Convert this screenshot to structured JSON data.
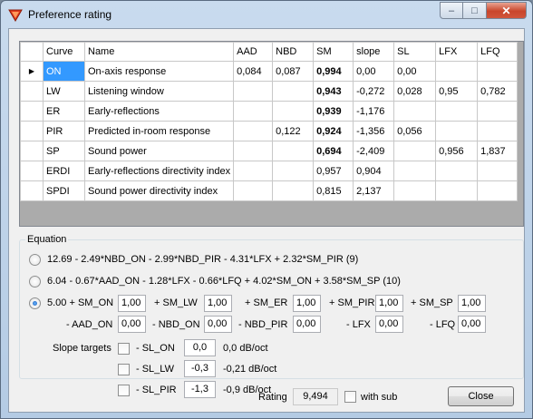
{
  "window": {
    "title": "Preference rating"
  },
  "caption_buttons": {
    "minimize": "–",
    "maximize": "□",
    "close": "✕"
  },
  "grid": {
    "columns": [
      "Curve",
      "Name",
      "AAD",
      "NBD",
      "SM",
      "slope",
      "SL",
      "LFX",
      "LFQ"
    ],
    "current_row_marker": "▶",
    "rows": [
      {
        "curve": "ON",
        "name": "On-axis response",
        "aad": "0,084",
        "nbd": "0,087",
        "sm": "0,994",
        "slope": "0,00",
        "sl": "0,00",
        "lfx": "",
        "lfq": ""
      },
      {
        "curve": "LW",
        "name": "Listening window",
        "aad": "",
        "nbd": "",
        "sm": "0,943",
        "slope": "-0,272",
        "sl": "0,028",
        "lfx": "0,95",
        "lfq": "0,782"
      },
      {
        "curve": "ER",
        "name": "Early-reflections",
        "aad": "",
        "nbd": "",
        "sm": "0,939",
        "slope": "-1,176",
        "sl": "",
        "lfx": "",
        "lfq": ""
      },
      {
        "curve": "PIR",
        "name": "Predicted in-room response",
        "aad": "",
        "nbd": "0,122",
        "sm": "0,924",
        "slope": "-1,356",
        "sl": "0,056",
        "lfx": "",
        "lfq": ""
      },
      {
        "curve": "SP",
        "name": "Sound power",
        "aad": "",
        "nbd": "",
        "sm": "0,694",
        "slope": "-2,409",
        "sl": "",
        "lfx": "0,956",
        "lfq": "1,837"
      },
      {
        "curve": "ERDI",
        "name": "Early-reflections directivity index",
        "aad": "",
        "nbd": "",
        "sm": "0,957",
        "slope": "0,904",
        "sl": "",
        "lfx": "",
        "lfq": ""
      },
      {
        "curve": "SPDI",
        "name": "Sound power directivity index",
        "aad": "",
        "nbd": "",
        "sm": "0,815",
        "slope": "2,137",
        "sl": "",
        "lfx": "",
        "lfq": ""
      }
    ]
  },
  "equation": {
    "label": "Equation",
    "option1": "12.69 - 2.49*NBD_ON - 2.99*NBD_PIR - 4.31*LFX + 2.32*SM_PIR (9)",
    "option2": "6.04 - 0.67*AAD_ON - 1.28*LFX - 0.66*LFQ + 4.02*SM_ON + 3.58*SM_SP (10)",
    "custom": {
      "const": "5.00 + SM_ON",
      "sm_on": "1,00",
      "sm_lw_label": "+ SM_LW",
      "sm_lw": "1,00",
      "sm_er_label": "+ SM_ER",
      "sm_er": "1,00",
      "sm_pir_label": "+ SM_PIR",
      "sm_pir": "1,00",
      "sm_sp_label": "+ SM_SP",
      "sm_sp": "1,00",
      "aad_on_label": "- AAD_ON",
      "aad_on": "0,00",
      "nbd_on_label": "- NBD_ON",
      "nbd_on": "0,00",
      "nbd_pir_label": "- NBD_PIR",
      "nbd_pir": "0,00",
      "lfx_label": "- LFX",
      "lfx": "0,00",
      "lfq_label": "- LFQ",
      "lfq": "0,00"
    },
    "slope_targets": {
      "label": "Slope targets",
      "on_label": "- SL_ON",
      "on_value": "0,0",
      "on_text": "0,0 dB/oct",
      "lw_label": "- SL_LW",
      "lw_value": "-0,3",
      "lw_text": "-0,21 dB/oct",
      "pir_label": "- SL_PIR",
      "pir_value": "-1,3",
      "pir_text": "-0,9 dB/oct"
    }
  },
  "footer": {
    "rating_label": "Rating",
    "rating_value": "9,494",
    "with_sub_label": "with sub",
    "close_label": "Close"
  }
}
